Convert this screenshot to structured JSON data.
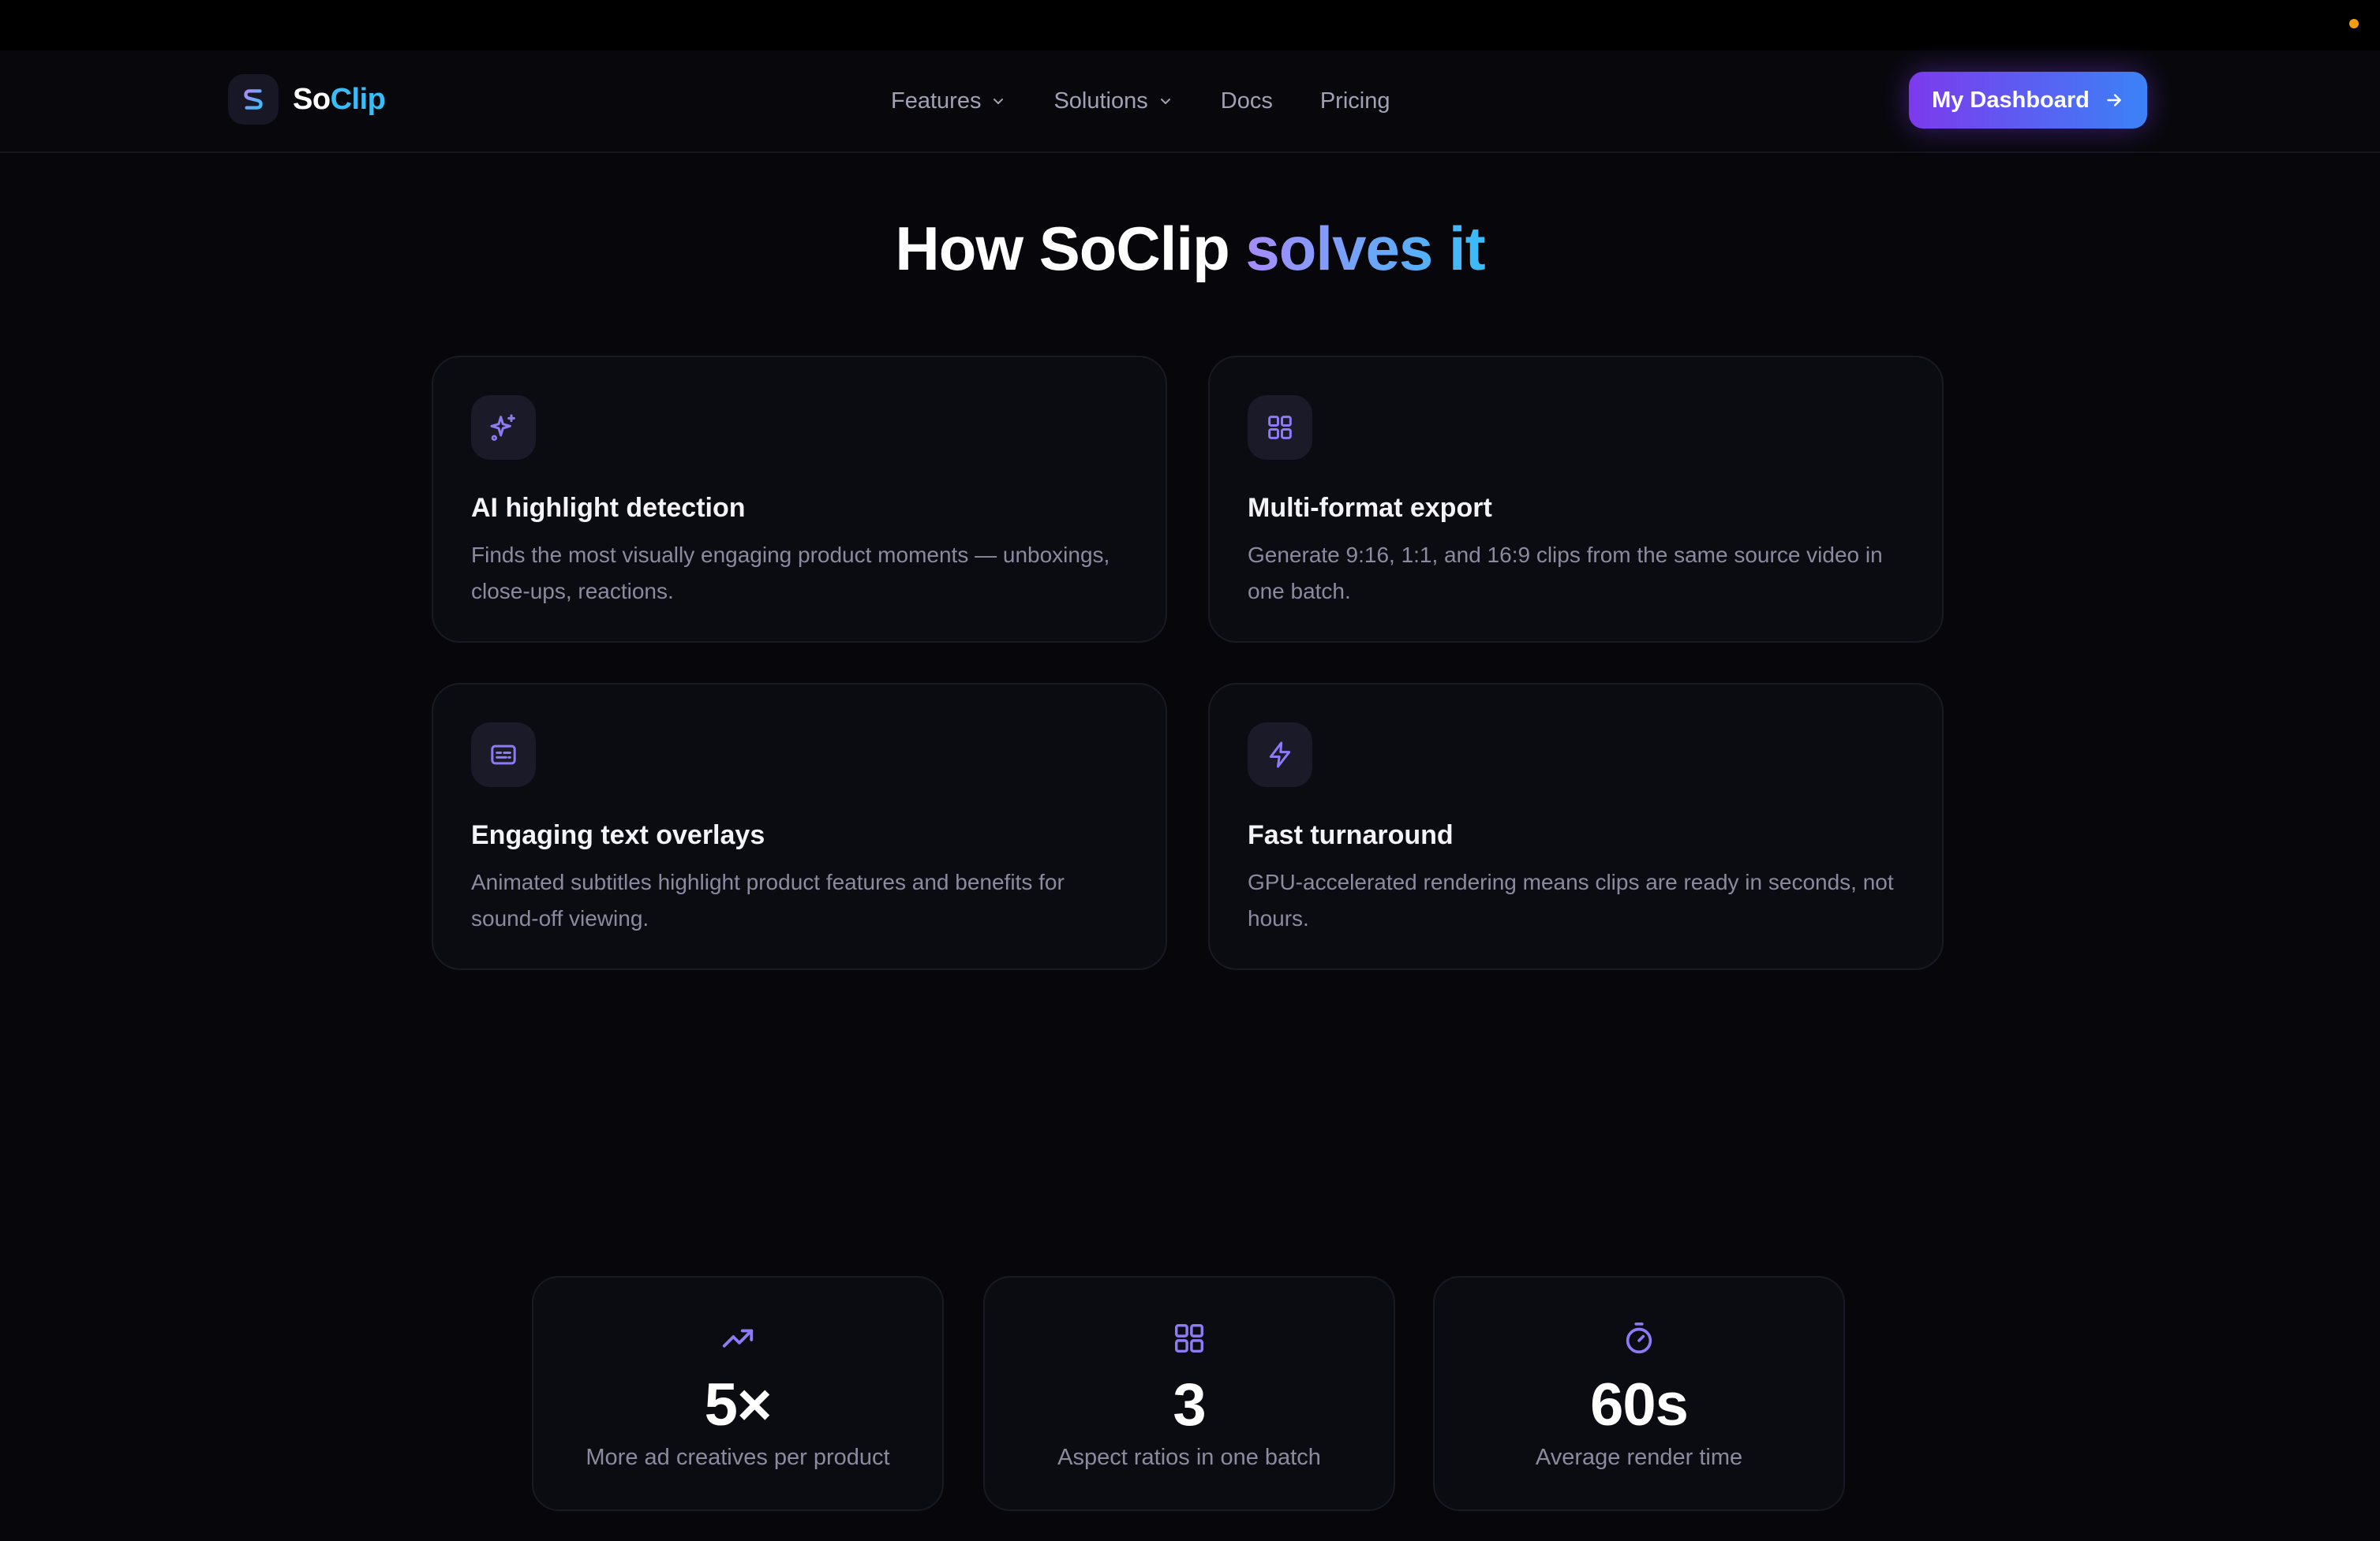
{
  "brand": {
    "name_part1": "So",
    "name_part2": "Clip"
  },
  "nav": {
    "items": [
      {
        "label": "Features",
        "has_dropdown": true
      },
      {
        "label": "Solutions",
        "has_dropdown": true
      },
      {
        "label": "Docs",
        "has_dropdown": false
      },
      {
        "label": "Pricing",
        "has_dropdown": false
      }
    ],
    "cta_label": "My Dashboard"
  },
  "heading": {
    "prefix": "How SoClip ",
    "highlight": "solves it"
  },
  "features": [
    {
      "icon": "sparkles-icon",
      "title": "AI highlight detection",
      "description": "Finds the most visually engaging product moments — unboxings, close-ups, reactions."
    },
    {
      "icon": "grid-icon",
      "title": "Multi-format export",
      "description": "Generate 9:16, 1:1, and 16:9 clips from the same source video in one batch."
    },
    {
      "icon": "captions-icon",
      "title": "Engaging text overlays",
      "description": "Animated subtitles highlight product features and benefits for sound-off viewing."
    },
    {
      "icon": "lightning-icon",
      "title": "Fast turnaround",
      "description": "GPU-accelerated rendering means clips are ready in seconds, not hours."
    }
  ],
  "stats": [
    {
      "icon": "trending-up-icon",
      "value": "5×",
      "label": "More ad creatives per product"
    },
    {
      "icon": "grid-icon",
      "value": "3",
      "label": "Aspect ratios in one batch"
    },
    {
      "icon": "stopwatch-icon",
      "value": "60s",
      "label": "Average render time"
    }
  ],
  "colors": {
    "accent_purple": "#7c3aed",
    "accent_blue": "#3b82f6",
    "accent_cyan": "#38bdf8",
    "icon_violet": "#8b7cf6",
    "background": "#07070b"
  }
}
